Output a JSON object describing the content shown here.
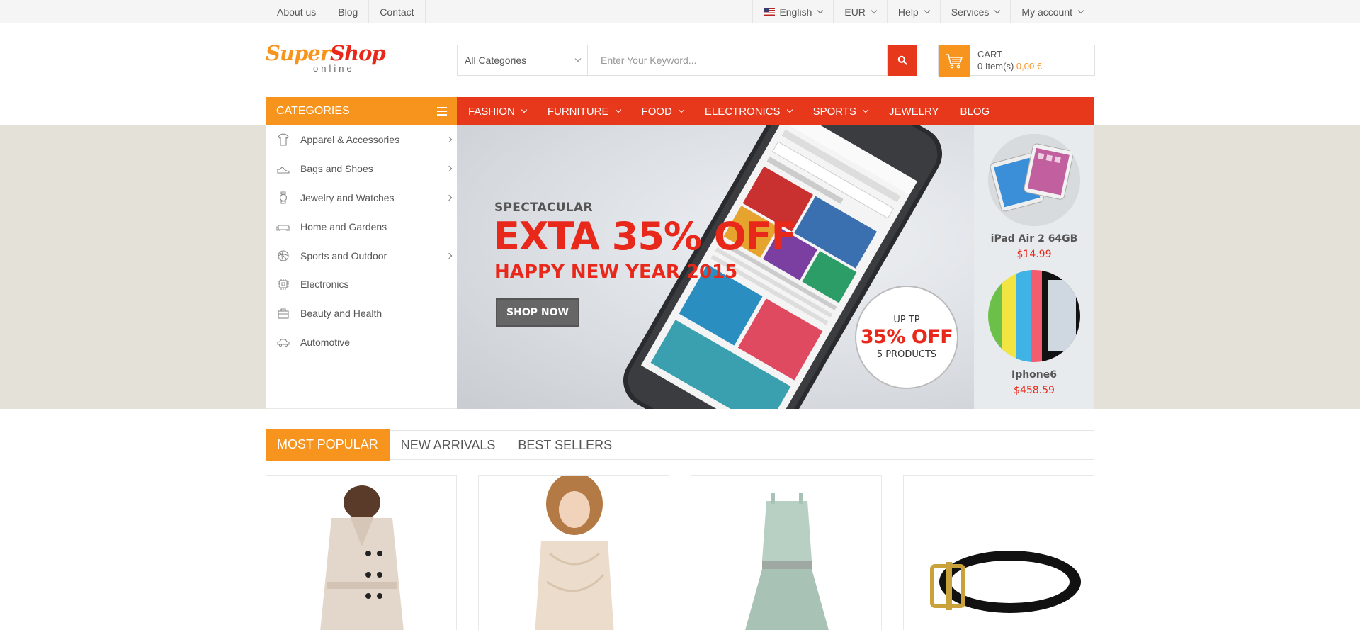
{
  "topbar": {
    "left_links": [
      "About us",
      "Blog",
      "Contact"
    ],
    "language": "English",
    "currency": "EUR",
    "help": "Help",
    "services": "Services",
    "account": "My account"
  },
  "logo": {
    "line1_a": "Super",
    "line1_b": "Shop",
    "line2": "online"
  },
  "search": {
    "category": "All Categories",
    "placeholder": "Enter Your Keyword..."
  },
  "cart": {
    "title": "CART",
    "items": "0 Item(s)",
    "total": "0,00 €"
  },
  "categories_header": "CATEGORIES",
  "nav": [
    {
      "label": "FASHION",
      "dropdown": true
    },
    {
      "label": "FURNITURE",
      "dropdown": true
    },
    {
      "label": "FOOD",
      "dropdown": true
    },
    {
      "label": "ELECTRONICS",
      "dropdown": true
    },
    {
      "label": "SPORTS",
      "dropdown": true
    },
    {
      "label": "JEWELRY",
      "dropdown": false
    },
    {
      "label": "BLOG",
      "dropdown": false
    }
  ],
  "category_menu": [
    {
      "label": "Apparel & Accessories",
      "icon": "shirt-icon",
      "submenu": true
    },
    {
      "label": "Bags and Shoes",
      "icon": "shoe-icon",
      "submenu": true
    },
    {
      "label": "Jewelry and Watches",
      "icon": "watch-icon",
      "submenu": true
    },
    {
      "label": "Home and Gardens",
      "icon": "sofa-icon",
      "submenu": false
    },
    {
      "label": "Sports and Outdoor",
      "icon": "ball-icon",
      "submenu": true
    },
    {
      "label": "Electronics",
      "icon": "chip-icon",
      "submenu": false
    },
    {
      "label": "Beauty and Health",
      "icon": "bag-icon",
      "submenu": false
    },
    {
      "label": "Automotive",
      "icon": "car-icon",
      "submenu": false
    }
  ],
  "banner": {
    "kicker": "SPECTACULAR",
    "headline": "EXTA 35% OFF",
    "subline": "HAPPY NEW YEAR 2015",
    "button": "SHOP NOW",
    "badge_top": "UP TP",
    "badge_mid": "35% OFF",
    "badge_bottom": "5 PRODUCTS"
  },
  "side_products": [
    {
      "name": "iPad Air 2 64GB",
      "price": "$14.99"
    },
    {
      "name": "Iphone6",
      "price": "$458.59"
    }
  ],
  "tabs": [
    "MOST POPULAR",
    "NEW ARRIVALS",
    "BEST SELLERS"
  ],
  "colors": {
    "orange": "#f7941d",
    "red": "#e8381b",
    "band": "#e4e2d8"
  }
}
